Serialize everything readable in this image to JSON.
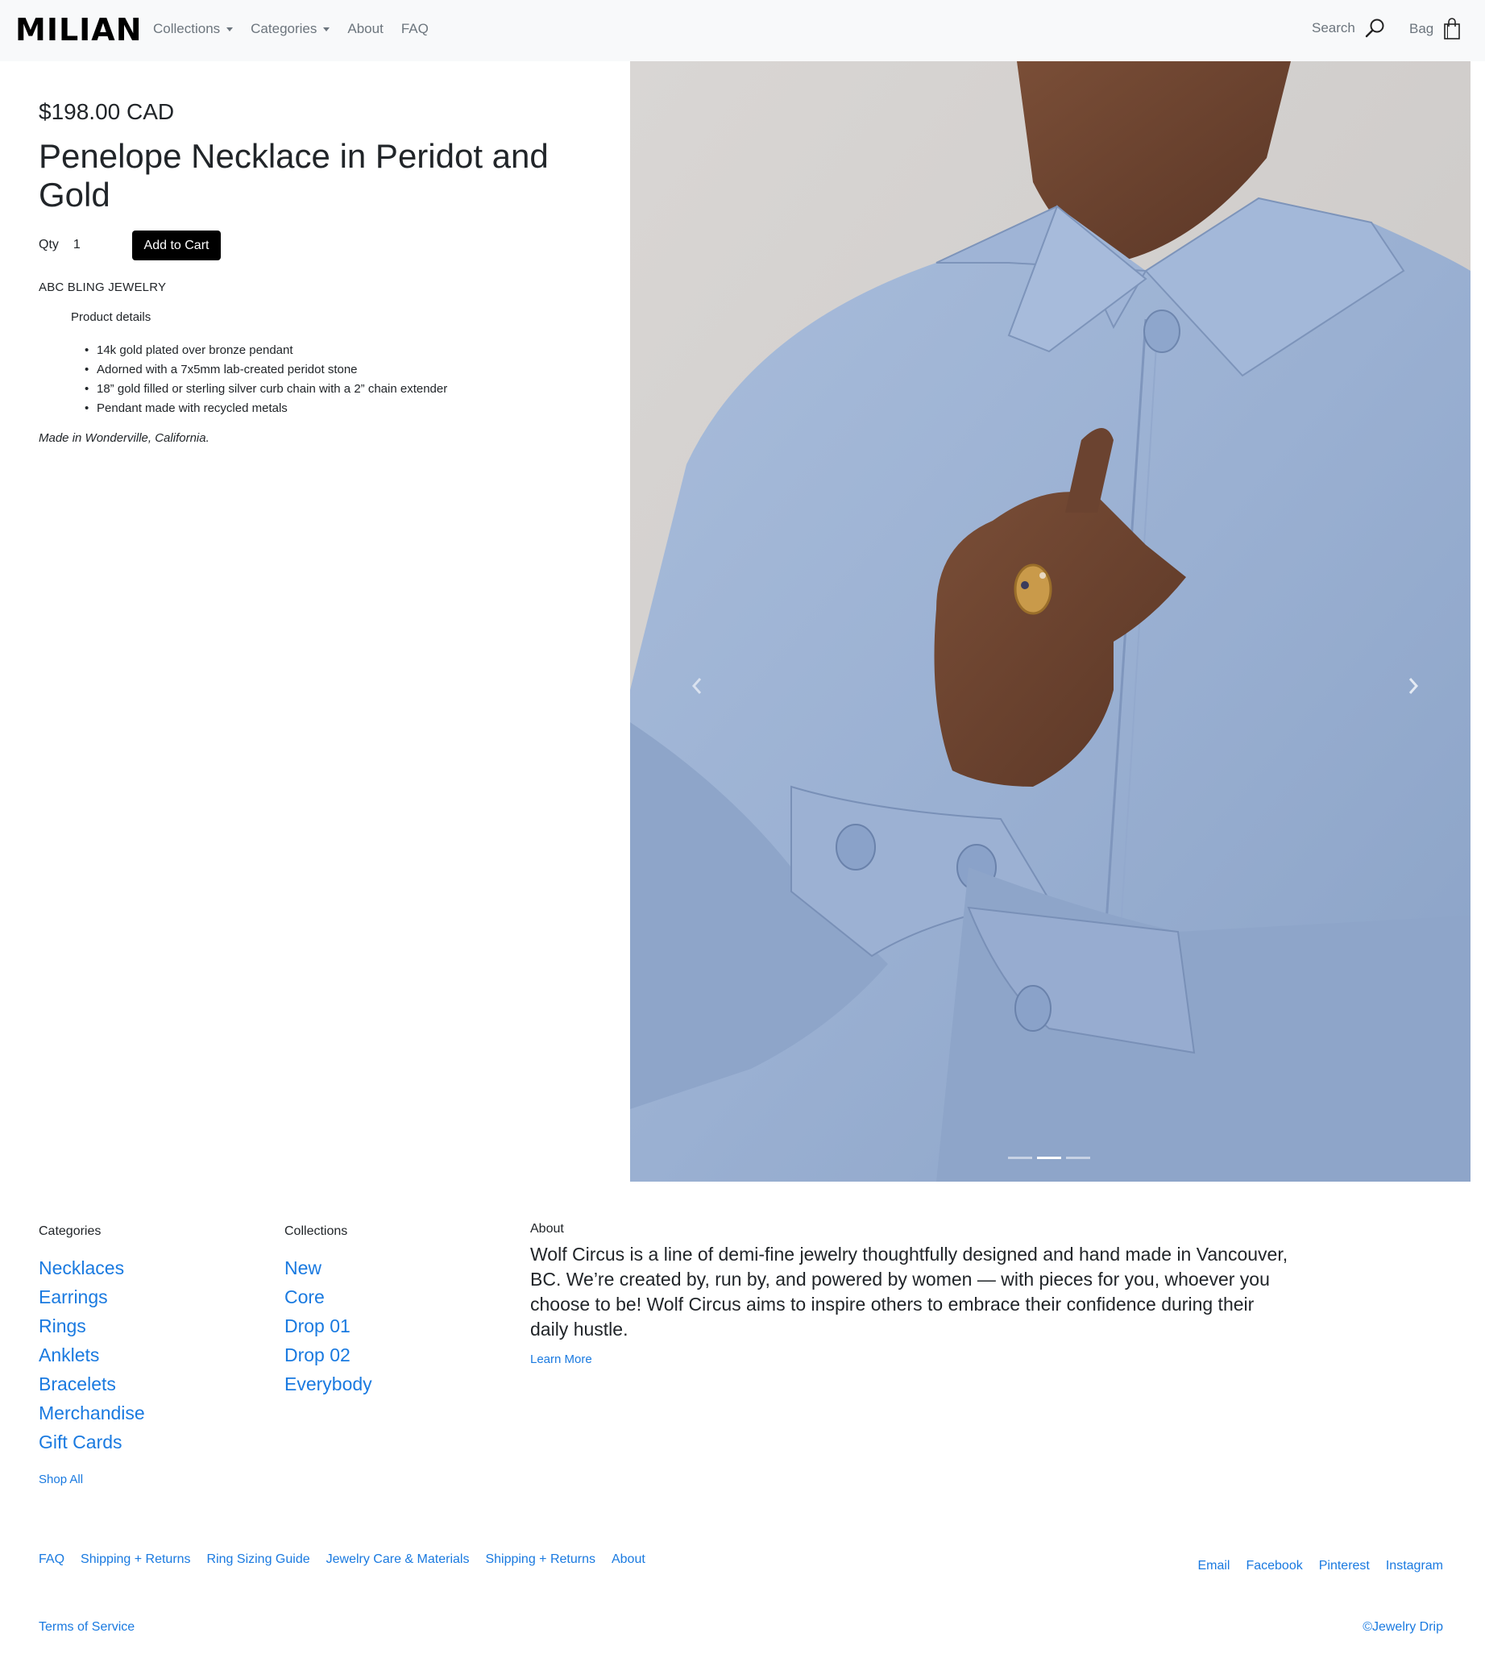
{
  "nav": {
    "brand": "MILIAN",
    "links": [
      {
        "label": "Collections",
        "dropdown": true
      },
      {
        "label": "Categories",
        "dropdown": true
      },
      {
        "label": "About",
        "dropdown": false
      },
      {
        "label": "FAQ",
        "dropdown": false
      }
    ],
    "search_label": "Search",
    "bag_label": "Bag"
  },
  "product": {
    "price": "$198.00 CAD",
    "title": "Penelope Necklace in Peridot and Gold",
    "qty_label": "Qty",
    "qty_value": "1",
    "add_to_cart": "Add to Cart",
    "brand": "ABC BLING JEWELRY",
    "details_heading": "Product details",
    "details": [
      "14k gold plated over bronze pendant",
      "Adorned with a 7x5mm lab-created peridot stone",
      "18” gold filled or sterling silver curb chain with a 2” chain extender",
      "Pendant made with recycled metals"
    ],
    "made_in": "Made in Wonderville, California."
  },
  "carousel": {
    "slide_count": 3,
    "active_index": 1
  },
  "footer": {
    "categories_heading": "Categories",
    "categories": [
      "Necklaces",
      "Earrings",
      "Rings",
      "Anklets",
      "Bracelets",
      "Merchandise",
      "Gift Cards"
    ],
    "shop_all": "Shop All",
    "collections_heading": "Collections",
    "collections": [
      "New",
      "Core",
      "Drop 01",
      "Drop 02",
      "Everybody"
    ],
    "about_heading": "About",
    "about_text": "Wolf Circus is a line of demi-fine jewelry thoughtfully designed and hand made in Vancouver, BC. We’re created by, run by, and powered by women — with pieces for you, whoever you choose to be! Wolf Circus aims to inspire others to embrace their confidence during their daily hustle.",
    "learn_more": "Learn More",
    "bottom_links": [
      "FAQ",
      "Shipping + Returns",
      "Ring Sizing Guide",
      "Jewelry Care & Materials",
      "Shipping + Returns",
      "About"
    ],
    "social_links": [
      "Email",
      "Facebook",
      "Pinterest",
      "Instagram"
    ],
    "terms": "Terms of Service",
    "copyright": "©Jewelry Drip"
  },
  "colors": {
    "link_blue": "#1a7ae0",
    "navbar_bg": "#f8f9fa",
    "button_black": "#000000"
  }
}
